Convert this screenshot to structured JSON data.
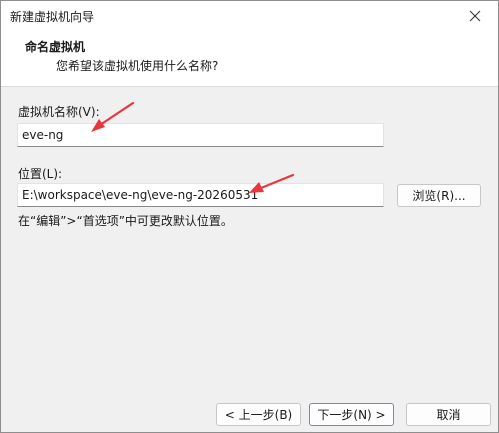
{
  "window": {
    "title": "新建虚拟机向导"
  },
  "header": {
    "heading": "命名虚拟机",
    "subheading": "您希望该虚拟机使用什么名称?"
  },
  "form": {
    "name_label": "虚拟机名称(V):",
    "name_value": "eve-ng",
    "location_label": "位置(L):",
    "location_value": "E:\\workspace\\eve-ng\\eve-ng-20260531",
    "browse_label": "浏览(R)...",
    "hint": "在“编辑”>“首选项”中可更改默认位置。"
  },
  "footer": {
    "back_label": "< 上一步(B)",
    "next_label": "下一步(N) >",
    "cancel_label": "取消"
  },
  "colors": {
    "annotation_arrow": "#e8383d",
    "default_button_border": "#5a8fd0"
  },
  "icons": {
    "close": "close-icon"
  }
}
